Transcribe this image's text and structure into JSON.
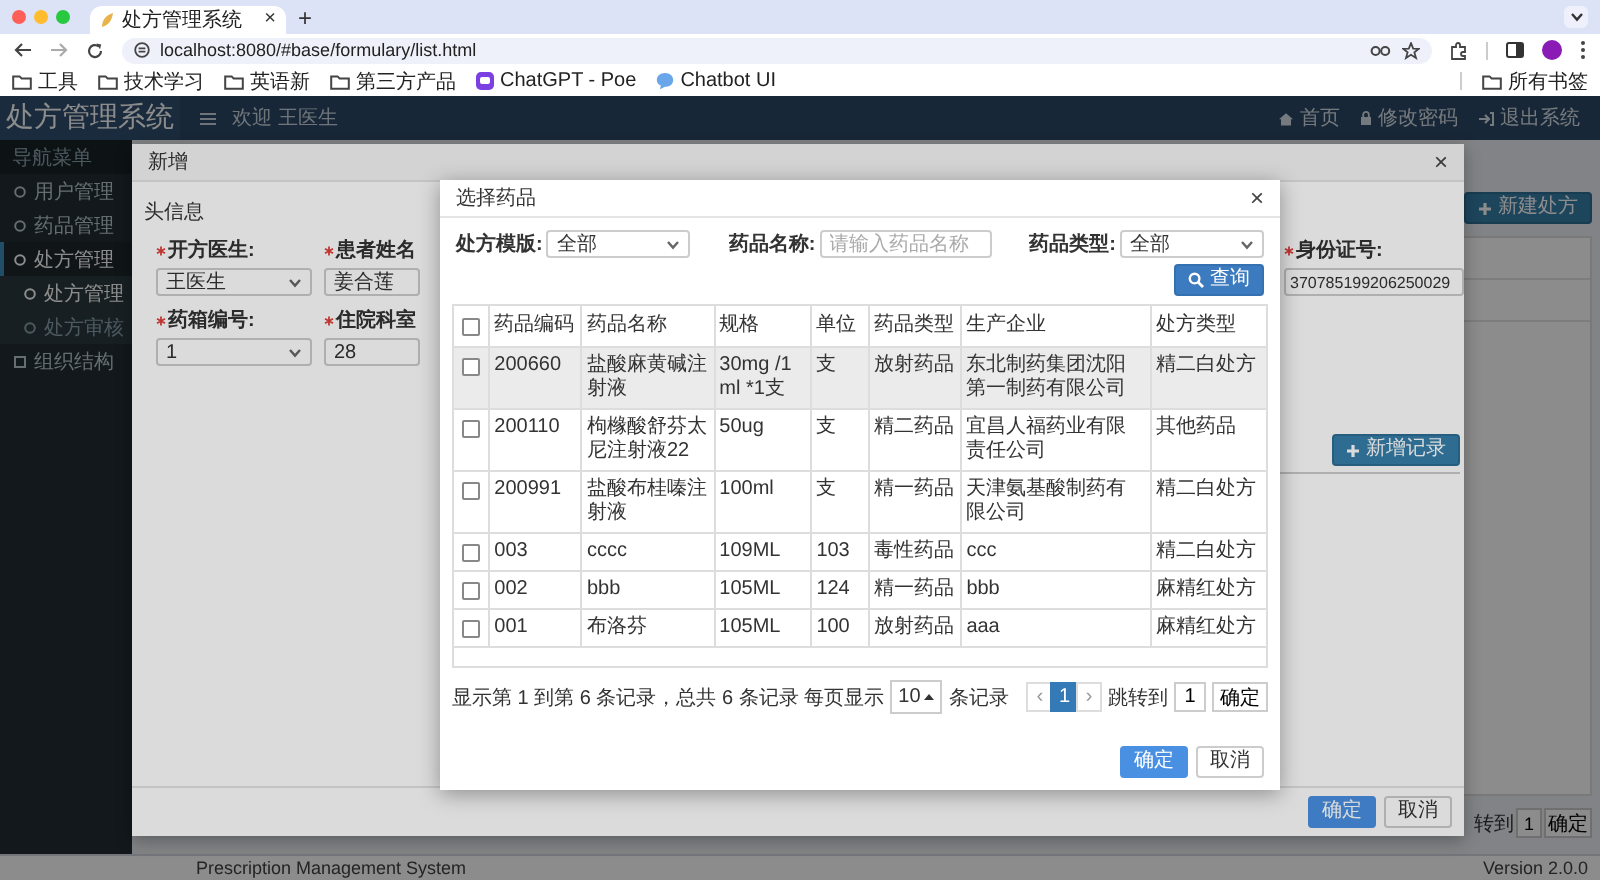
{
  "browser": {
    "tab_title": "处方管理系统",
    "tab_close": "×",
    "new_tab": "+",
    "url": "localhost:8080/#base/formulary/list.html",
    "bookmarks": [
      {
        "label": "工具",
        "kind": "folder"
      },
      {
        "label": "技术学习",
        "kind": "folder"
      },
      {
        "label": "英语新",
        "kind": "folder"
      },
      {
        "label": "第三方产品",
        "kind": "folder"
      },
      {
        "label": "ChatGPT - Poe",
        "kind": "poe"
      },
      {
        "label": "Chatbot UI",
        "kind": "chat"
      }
    ],
    "all_bookmarks": "所有书签"
  },
  "header": {
    "title": "处方管理系统",
    "welcome": "欢迎 王医生",
    "nav": [
      {
        "label": "首页",
        "kind": "home"
      },
      {
        "label": "修改密码",
        "kind": "lock"
      },
      {
        "label": "退出系统",
        "kind": "logout"
      }
    ]
  },
  "sidebar": {
    "heading": "导航菜单",
    "items": [
      {
        "label": "用户管理",
        "kind": "circle",
        "selected": false
      },
      {
        "label": "药品管理",
        "kind": "circle",
        "selected": false
      },
      {
        "label": "处方管理",
        "kind": "circle",
        "selected": true,
        "children": [
          {
            "label": "处方管理",
            "selected": true
          },
          {
            "label": "处方审核",
            "selected": false
          }
        ]
      },
      {
        "label": "组织结构",
        "kind": "square",
        "selected": false
      }
    ]
  },
  "main": {
    "new_button": "新建处方",
    "pager": {
      "jump_label": "转到",
      "page": "1",
      "go": "确定"
    }
  },
  "footer": {
    "left": "Prescription Management System",
    "right": "Version 2.0.0"
  },
  "add_dialog": {
    "title": "新增",
    "close": "×",
    "section": "头信息",
    "fields": [
      {
        "label": "开方医生:",
        "kind": "select",
        "value": "王医生",
        "required": true
      },
      {
        "label": "患者姓名",
        "kind": "input",
        "value": "姜合莲",
        "required": true
      },
      {
        "label": "身份证号:",
        "kind": "input",
        "value": "370785199206250029",
        "required": true
      },
      {
        "label": "药箱编号:",
        "kind": "select",
        "value": "1",
        "required": true
      },
      {
        "label": "住院科室",
        "kind": "input",
        "value": "28",
        "required": true
      }
    ],
    "add_record": "新增记录",
    "buttons": [
      {
        "label": "确定",
        "kind": "primary"
      },
      {
        "label": "取消",
        "kind": "default"
      }
    ]
  },
  "drug_dialog": {
    "title": "选择药品",
    "close": "×",
    "filters": [
      {
        "label": "处方模版:",
        "kind": "select",
        "value": "全部"
      },
      {
        "label": "药品名称:",
        "kind": "input",
        "placeholder": "请输入药品名称"
      },
      {
        "label": "药品类型:",
        "kind": "select",
        "value": "全部"
      }
    ],
    "search_button": "查询",
    "table": {
      "all_checked": false,
      "columns": [
        "药品编码",
        "药品名称",
        "规格",
        "单位",
        "药品类型",
        "生产企业",
        "处方类型"
      ],
      "rows": [
        {
          "checked": false,
          "highlighted": true,
          "cells": [
            "200660",
            "盐酸麻黄碱注射液",
            "30mg /1ml *1支",
            "支",
            "放射药品",
            "东北制药集团沈阳第一制药有限公司",
            "精二白处方"
          ]
        },
        {
          "checked": false,
          "highlighted": false,
          "cells": [
            "200110",
            "枸橼酸舒芬太尼注射液22",
            "50ug",
            "支",
            "精二药品",
            "宜昌人福药业有限责任公司",
            "其他药品"
          ]
        },
        {
          "checked": false,
          "highlighted": false,
          "cells": [
            "200991",
            "盐酸布桂嗪注射液",
            "100ml",
            "支",
            "精一药品",
            "天津氨基酸制药有限公司",
            "精二白处方"
          ]
        },
        {
          "checked": false,
          "highlighted": false,
          "cells": [
            "003",
            "cccc",
            "109ML",
            "103",
            "毒性药品",
            "ccc",
            "精二白处方"
          ]
        },
        {
          "checked": false,
          "highlighted": false,
          "cells": [
            "002",
            "bbb",
            "105ML",
            "124",
            "精一药品",
            "bbb",
            "麻精红处方"
          ]
        },
        {
          "checked": false,
          "highlighted": false,
          "cells": [
            "001",
            "布洛芬",
            "105ML",
            "100",
            "放射药品",
            "aaa",
            "麻精红处方"
          ]
        }
      ]
    },
    "pager": {
      "summary": "显示第 1 到第 6 条记录，总共 6 条记录 每页显示",
      "page_size": "10",
      "page_size_suffix": "条记录",
      "prev": "‹",
      "pages": [
        {
          "label": "1",
          "selected": true
        }
      ],
      "next": "›",
      "jump_label": "跳转到",
      "jump_value": "1",
      "go": "确定"
    },
    "buttons": [
      {
        "label": "确定",
        "kind": "primary"
      },
      {
        "label": "取消",
        "kind": "default"
      }
    ]
  }
}
